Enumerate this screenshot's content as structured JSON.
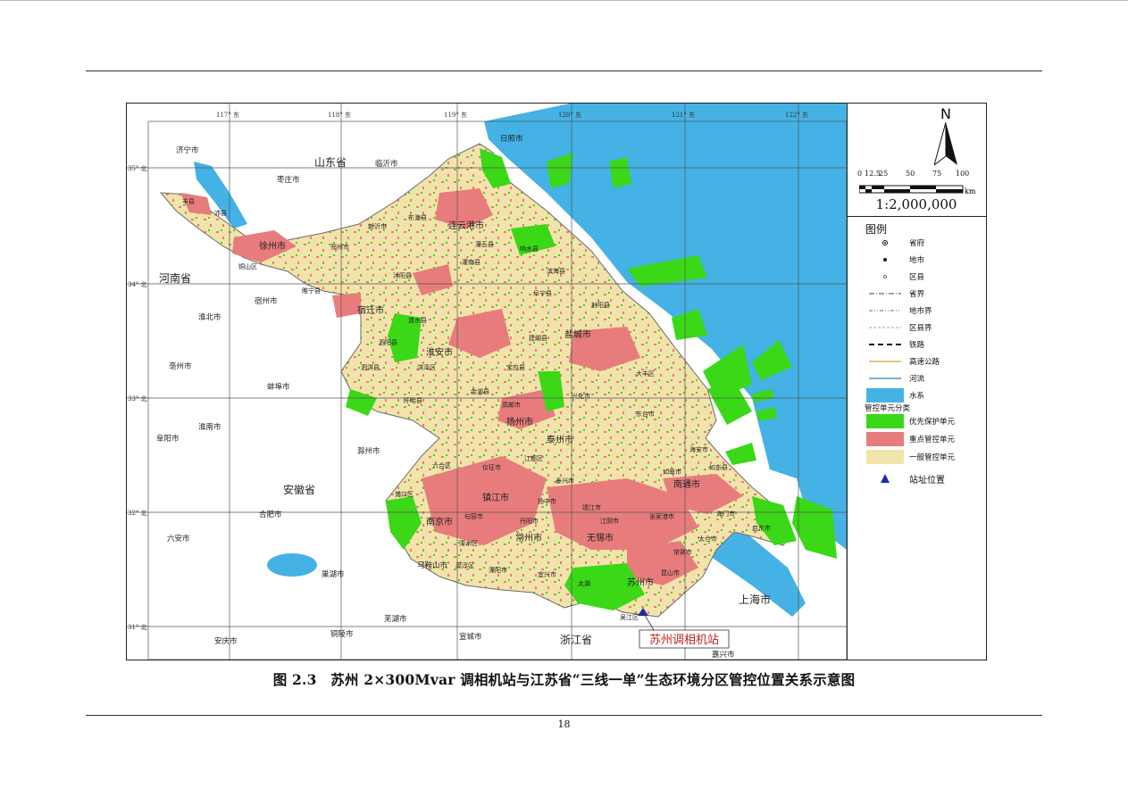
{
  "figure": {
    "caption": "图 2.3　苏州 2×300Mvar 调相机站与江苏省“三线一单”生态环境分区管控位置关系示意图",
    "page_number": "18"
  },
  "map": {
    "grid_top_labels": [
      "117° 东",
      "118° 东",
      "119° 东",
      "120° 东",
      "121° 东",
      "122° 东"
    ],
    "grid_left_labels": [
      "35° 北",
      "34° 北",
      "33° 北",
      "32° 北",
      "31° 北"
    ],
    "province_labels": {
      "shandong": "山东省",
      "henan": "河南省",
      "anhui": "安徽省",
      "zhejiang": "浙江省",
      "shanghai": "上海市"
    },
    "outside_cities": [
      "济宁市",
      "枣庄市",
      "临沂市",
      "日照市",
      "宿州市",
      "淮北市",
      "亳州市",
      "蚌埠市",
      "淮南市",
      "阜阳市",
      "滁州市",
      "合肥市",
      "六安市",
      "巢湖市",
      "马鞍山市",
      "芜湖市",
      "铜陵市",
      "安庆市",
      "宣城市",
      "嘉兴市"
    ],
    "jiangsu_cities": [
      "徐州市",
      "连云港市",
      "宿迁市",
      "淮安市",
      "盐城市",
      "扬州市",
      "泰州市",
      "南京市",
      "镇江市",
      "常州市",
      "无锡市",
      "南通市",
      "苏州市"
    ],
    "jiangsu_districts": [
      "沛县",
      "丰县",
      "铜山区",
      "睢宁县",
      "邳州市",
      "新沂市",
      "东海县",
      "灌云县",
      "灌南县",
      "响水县",
      "滨海县",
      "阜宁县",
      "射阳县",
      "建湖县",
      "大丰区",
      "东台市",
      "兴化市",
      "高邮市",
      "宝应县",
      "金湖县",
      "盱眙县",
      "洪泽区",
      "涟水县",
      "沭阳县",
      "泗阳县",
      "泗洪县",
      "仪征市",
      "江都区",
      "海安市",
      "如皋市",
      "如东县",
      "海门市",
      "启东市",
      "靖江市",
      "泰兴市",
      "江阴市",
      "张家港市",
      "常熟市",
      "太仓市",
      "昆山市",
      "吴江区",
      "宜兴市",
      "溧阳市",
      "句容市",
      "丹阳市",
      "扬中市",
      "高淳区",
      "溧水区",
      "六合区",
      "浦口区",
      "太湖"
    ],
    "station_callout": "苏州调相机站"
  },
  "legend": {
    "title": "图例",
    "items": [
      {
        "key": "capital",
        "label": "省府"
      },
      {
        "key": "prefecture",
        "label": "地市"
      },
      {
        "key": "county",
        "label": "区县"
      },
      {
        "key": "prov_border",
        "label": "省界"
      },
      {
        "key": "pref_border",
        "label": "地市界"
      },
      {
        "key": "county_border",
        "label": "区县界"
      },
      {
        "key": "railway",
        "label": "铁路"
      },
      {
        "key": "highway",
        "label": "高速公路"
      },
      {
        "key": "river",
        "label": "河流"
      },
      {
        "key": "water",
        "label": "水系"
      }
    ],
    "unit_heading": "管控单元分类",
    "units": [
      {
        "label": "优先保护单元",
        "color": "#3ad817"
      },
      {
        "label": "重点管控单元",
        "color": "#e87c7c"
      },
      {
        "label": "一般管控单元",
        "color": "#f1e4aa"
      }
    ],
    "site_label": "站址位置"
  },
  "scale": {
    "ticks": [
      "0",
      "12.5",
      "25",
      "50",
      "75",
      "100"
    ],
    "unit": "km",
    "ratio": "1:2,000,000",
    "north": "N"
  },
  "colors": {
    "sea": "#44b2e4",
    "priority": "#3ad817",
    "key": "#e87c7c",
    "general": "#f1e4aa",
    "site_marker": "#1a2ab0"
  }
}
